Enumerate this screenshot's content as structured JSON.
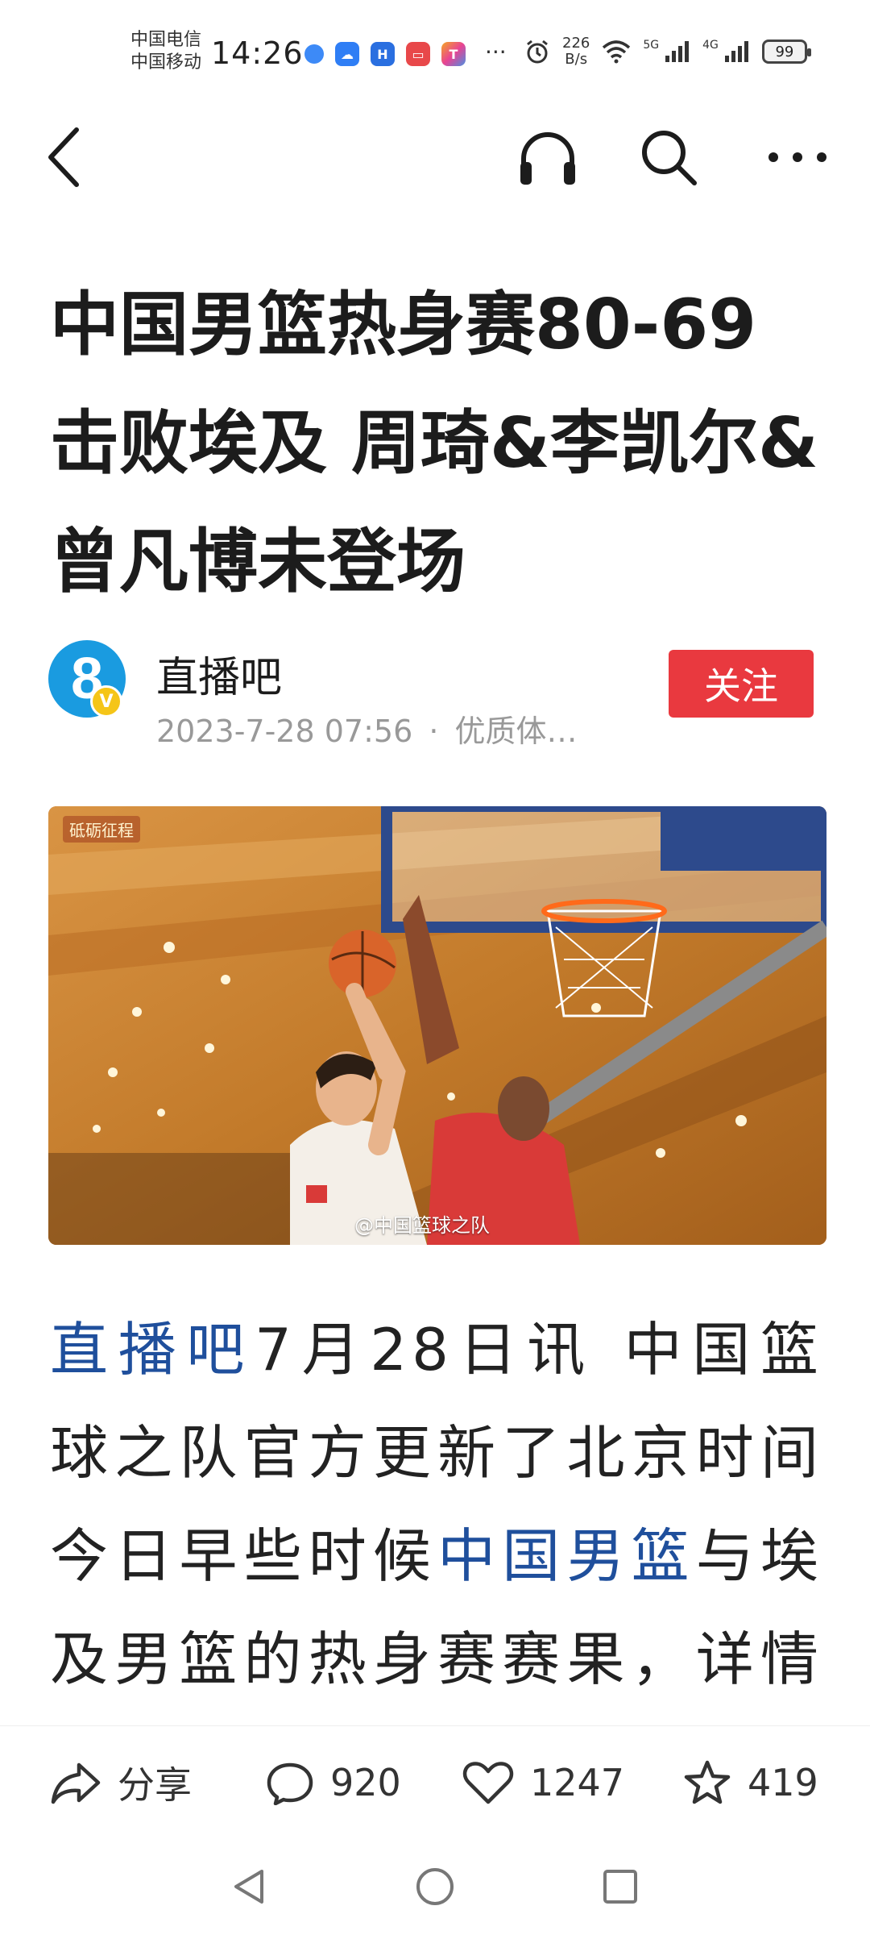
{
  "status_bar": {
    "carrier_1": "中国电信",
    "carrier_2": "中国移动",
    "time": "14:26",
    "more": "···",
    "net_speed_value": "226",
    "net_speed_unit": "B/s",
    "signal_1_label": "5G",
    "signal_2_label": "4G",
    "battery": "99"
  },
  "header": {
    "back_icon": "chevron-left-icon",
    "listen_icon": "headphones-icon",
    "search_icon": "search-icon",
    "more_icon": "more-dots-icon"
  },
  "article": {
    "title": "中国男篮热身赛80-69击败埃及 周琦&李凯尔&曾凡博未登场",
    "author": {
      "avatar_text": "8",
      "verified_text": "V",
      "name": "直播吧",
      "date": "2023-7-28 07:56",
      "separator": "·",
      "tag": "优质体…"
    },
    "follow_label": "关注",
    "image": {
      "watermark_top": "砥砺征程",
      "watermark_bottom": "@中国篮球之队"
    },
    "body": {
      "link_1": "直播吧",
      "text_1": "7月28日讯 中国篮球之队官方更新了北京时间今日早些时候",
      "link_2": "中国男篮",
      "text_2": "与埃及男篮的热身赛赛果，详情如"
    }
  },
  "actions": {
    "share_label": "分享",
    "comments": "920",
    "likes": "1247",
    "favorites": "419"
  },
  "colors": {
    "follow_bg": "#e9393f",
    "link": "#1f4f9c",
    "meta_text": "#999999"
  }
}
